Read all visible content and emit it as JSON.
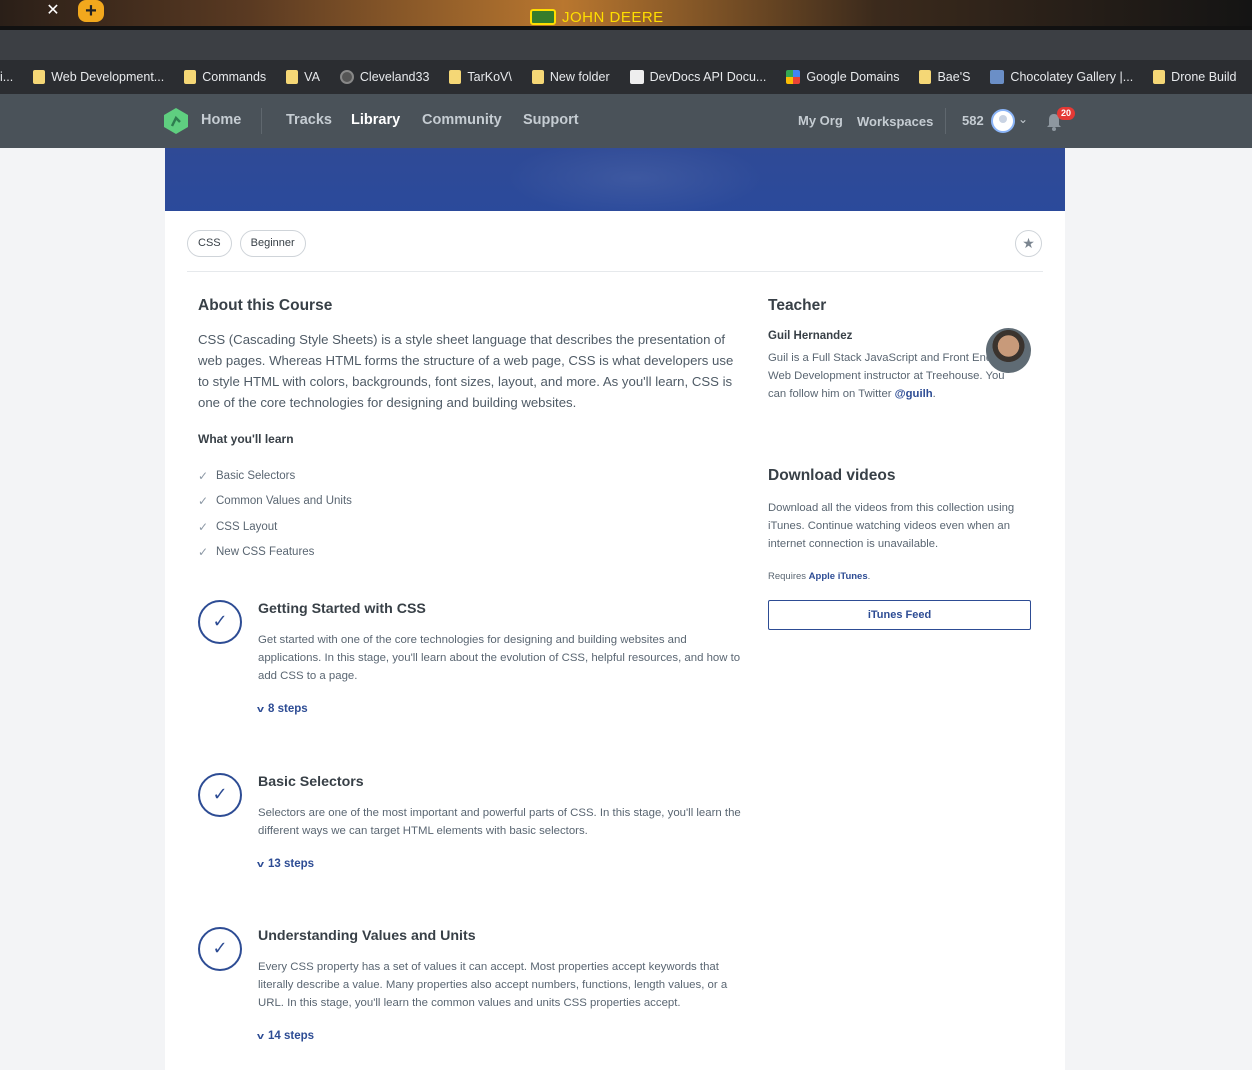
{
  "browser": {
    "close_tab": "✕",
    "new_tab": "+",
    "brand_text": "JOHN DEERE",
    "bookmarks": [
      {
        "label": "i...",
        "icon": "folder-icon"
      },
      {
        "label": "Web Development...",
        "icon": "folder-icon"
      },
      {
        "label": "Commands",
        "icon": "folder-icon"
      },
      {
        "label": "VA",
        "icon": "folder-icon"
      },
      {
        "label": "Cleveland33",
        "icon": "github-icon"
      },
      {
        "label": "TarKoV\\",
        "icon": "folder-icon"
      },
      {
        "label": "New folder",
        "icon": "folder-icon"
      },
      {
        "label": "DevDocs API Docu...",
        "icon": "devdocs-icon"
      },
      {
        "label": "Google Domains",
        "icon": "google-domains-icon"
      },
      {
        "label": "Bae'S",
        "icon": "folder-icon"
      },
      {
        "label": "Chocolatey Gallery |...",
        "icon": "chocolatey-icon"
      },
      {
        "label": "Drone Build",
        "icon": "folder-icon"
      },
      {
        "label": "",
        "icon": "hfs-icon"
      }
    ]
  },
  "nav": {
    "home": "Home",
    "tracks": "Tracks",
    "library": "Library",
    "community": "Community",
    "support": "Support",
    "my_org": "My Org",
    "workspaces": "Workspaces",
    "points": "582",
    "notifications": "20"
  },
  "course": {
    "tags": [
      "CSS",
      "Beginner"
    ],
    "about_title": "About this Course",
    "about_text": "CSS (Cascading Style Sheets) is a style sheet language that describes the presentation of web pages. Whereas HTML forms the structure of a web page, CSS is what developers use to style HTML with colors, backgrounds, font sizes, layout, and more. As you'll learn, CSS is one of the core technologies for designing and building websites.",
    "learn_title": "What you'll learn",
    "learn_items": [
      "Basic Selectors",
      "Common Values and Units",
      "CSS Layout",
      "New CSS Features"
    ],
    "stages": [
      {
        "title": "Getting Started with CSS",
        "desc": "Get started with one of the core technologies for designing and building websites and applications. In this stage, you'll learn about the evolution of CSS, helpful resources, and how to add CSS to a page.",
        "steps": "8 steps"
      },
      {
        "title": "Basic Selectors",
        "desc": "Selectors are one of the most important and powerful parts of CSS. In this stage, you'll learn the different ways we can target HTML elements with basic selectors.",
        "steps": "13 steps"
      },
      {
        "title": "Understanding Values and Units",
        "desc": "Every CSS property has a set of values it can accept. Most properties accept keywords that literally describe a value. Many properties also accept numbers, functions, length values, or a URL. In this stage, you'll learn the common values and units CSS properties accept.",
        "steps": "14 steps"
      }
    ]
  },
  "sidebar": {
    "teacher_title": "Teacher",
    "teacher_name": "Guil Hernandez",
    "teacher_bio": "Guil is a Full Stack JavaScript and Front End Web Development instructor at Treehouse. You can follow him on Twitter",
    "twitter_handle": "@guilh",
    "bio_end": ".",
    "download_title": "Download videos",
    "download_text": "Download all the videos from this collection using iTunes. Continue watching videos even when an internet connection is unavailable.",
    "requires_label": "Requires",
    "requires_link": "Apple iTunes",
    "requires_end": ".",
    "itunes_button": "iTunes Feed"
  },
  "colors": {
    "nav_bg": "#4a5259",
    "accent": "#2d4c94",
    "hero": "#2b4a9b",
    "badge": "#e53935"
  }
}
